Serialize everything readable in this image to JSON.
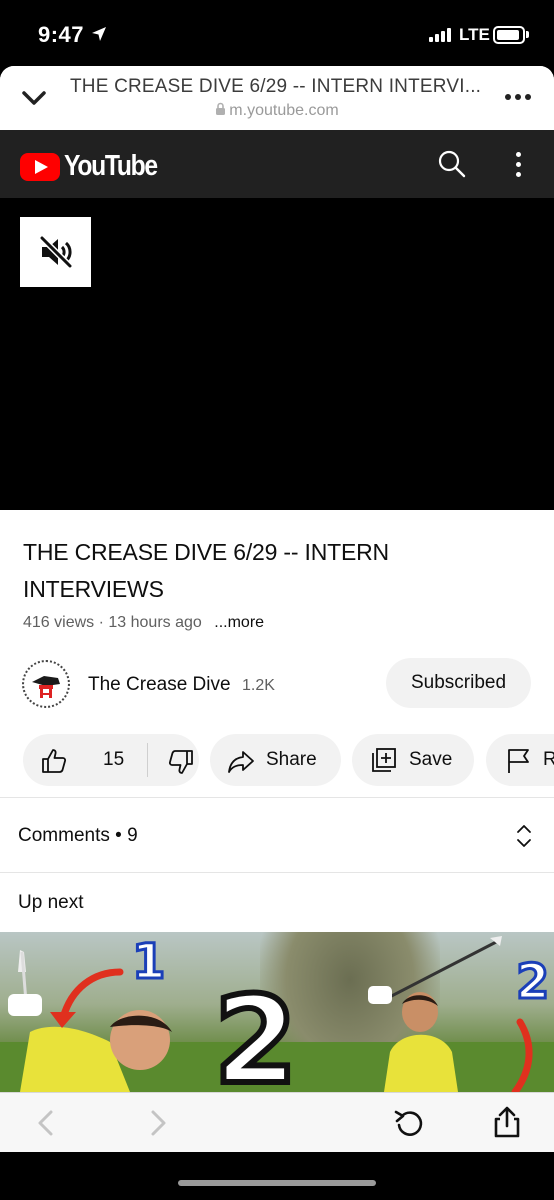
{
  "status_bar": {
    "time": "9:47",
    "network": "LTE"
  },
  "browser": {
    "page_title": "THE CREASE DIVE 6/29 -- INTERN INTERVI...",
    "url": "m.youtube.com"
  },
  "youtube": {
    "logo_text": "YouTube",
    "video": {
      "title": "THE CREASE DIVE 6/29 -- INTERN INTERVIEWS",
      "views": "416 views",
      "separator": "·",
      "age": "13 hours ago",
      "more_label": "...more"
    },
    "channel": {
      "name": "The Crease Dive",
      "subscribers": "1.2K",
      "subscribe_state": "Subscribed"
    },
    "actions": {
      "likes": "15",
      "share_label": "Share",
      "save_label": "Save",
      "report_label": "R"
    },
    "comments": {
      "label": "Comments",
      "separator": "•",
      "count": "9"
    },
    "up_next_label": "Up next",
    "thumbnail": {
      "number_left": "1",
      "number_center": "2",
      "number_right": "2"
    }
  },
  "colors": {
    "youtube_red": "#ff0000",
    "header_bg": "#212121",
    "pill_bg": "#f2f2f2",
    "thumbnail_accent": "#e0301e"
  },
  "icons": {
    "status": [
      "location-arrow-icon",
      "signal-icon",
      "battery-icon"
    ],
    "browser": [
      "chevron-down-icon",
      "lock-icon",
      "more-icon"
    ],
    "header": [
      "youtube-logo-icon",
      "search-icon",
      "kebab-icon"
    ],
    "player": [
      "mute-icon"
    ],
    "actions": [
      "like-icon",
      "dislike-icon",
      "share-icon",
      "save-icon",
      "report-icon"
    ],
    "comments": [
      "expand-icon"
    ],
    "toolbar": [
      "back-icon",
      "forward-icon",
      "reload-icon",
      "share-icon"
    ]
  }
}
